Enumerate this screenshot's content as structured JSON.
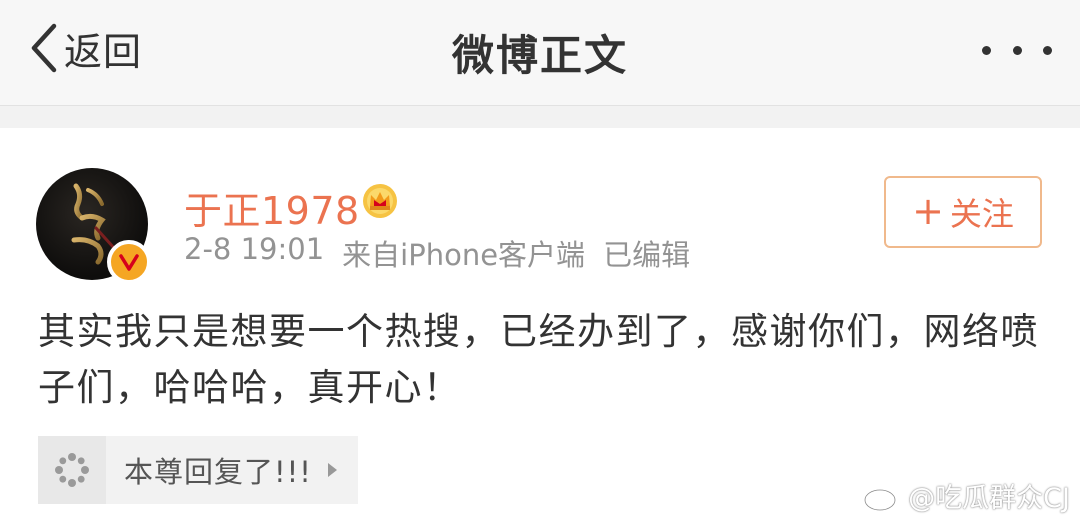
{
  "header": {
    "back_label": "返回",
    "title": "微博正文"
  },
  "post": {
    "username": "于正1978",
    "timestamp": "2-8 19:01",
    "source": "来自iPhone客户端",
    "edited": "已编辑",
    "follow_label": "关注",
    "content": "其实我只是想要一个热搜，已经办到了，感谢你们，网络喷子们，哈哈哈，真开心！",
    "repost_label": "本尊回复了!!!",
    "avatar_text": "皓镧传",
    "verified_mark": "v"
  },
  "watermark": {
    "text": "@吃瓜群众CJ"
  },
  "colors": {
    "accent": "#eb7350",
    "verified": "#f5a623",
    "header_bg": "#f7f7f7",
    "text_primary": "#333333",
    "text_secondary": "#939393"
  },
  "icons": [
    "chevron-left-icon",
    "more-dots-icon",
    "crown-icon",
    "verified-icon",
    "plus-icon",
    "repost-loading-icon",
    "chevron-right-icon",
    "weibo-logo-icon"
  ]
}
